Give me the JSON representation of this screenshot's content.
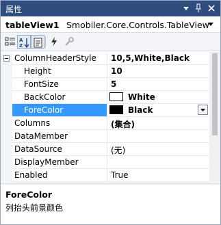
{
  "window": {
    "title": "属性",
    "buttons": {
      "dropdown": "▾",
      "pin": "📌",
      "close": "✕"
    }
  },
  "selector": {
    "object_name": "tableView1",
    "object_type": "Smobiler.Core.Controls.TableView"
  },
  "toolbar": {
    "tools": [
      {
        "icon": "categorized-icon",
        "pressed": false
      },
      {
        "icon": "alphabetical-sort-icon",
        "pressed": true
      },
      {
        "icon": "properties-page-icon",
        "pressed": true
      },
      {
        "icon": "events-lightning-icon",
        "pressed": false
      },
      {
        "icon": "property-pages-wrench-icon",
        "pressed": false
      }
    ]
  },
  "grid": {
    "rows": [
      {
        "name": "ColumnHeaderStyle",
        "value": "10,5,White,Black",
        "bold": true,
        "expander": "minus"
      },
      {
        "name": "Height",
        "value": "10",
        "bold": true,
        "indent": true
      },
      {
        "name": "FontSize",
        "value": "5",
        "bold": true,
        "indent": true
      },
      {
        "name": "BackColor",
        "value": "White",
        "bold": true,
        "indent": true,
        "swatch": "#FFFFFF"
      },
      {
        "name": "ForeColor",
        "value": "Black",
        "bold": true,
        "indent": true,
        "swatch": "#000000",
        "selected": true
      },
      {
        "name": "Columns",
        "value": "(集合)",
        "bold": true
      },
      {
        "name": "DataMember",
        "value": ""
      },
      {
        "name": "DataSource",
        "value": "(无)"
      },
      {
        "name": "DisplayMember",
        "value": ""
      },
      {
        "name": "Enabled",
        "value": "True"
      }
    ]
  },
  "description": {
    "title": "ForeColor",
    "text": "列抬头前景颜色"
  },
  "colors": {
    "titlebar": "#2E4C7E",
    "selection": "#3399FF",
    "gutter": "#F2F4F8"
  }
}
